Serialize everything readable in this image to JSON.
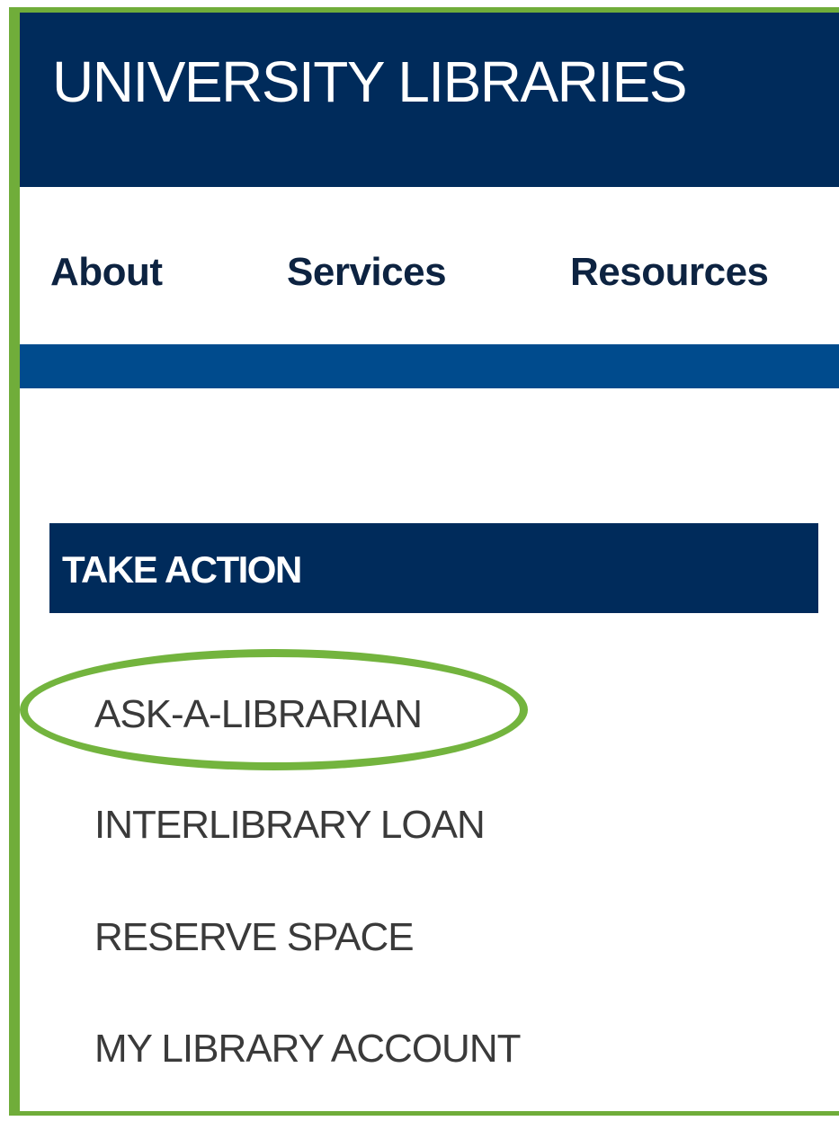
{
  "header": {
    "site_title": "UNIVERSITY LIBRARIES",
    "background_color": "#002b5b"
  },
  "nav": {
    "items": [
      {
        "label": "About"
      },
      {
        "label": "Services"
      },
      {
        "label": "Resources"
      }
    ],
    "bar_color": "#004b8d"
  },
  "take_action": {
    "heading": "TAKE ACTION",
    "links": [
      {
        "label": "ASK-A-LIBRARIAN",
        "highlighted": true
      },
      {
        "label": "INTERLIBRARY LOAN"
      },
      {
        "label": "RESERVE SPACE"
      },
      {
        "label": "MY LIBRARY ACCOUNT"
      }
    ]
  },
  "annotation": {
    "color": "#73b43e",
    "highlight_target": "ASK-A-LIBRARIAN"
  }
}
